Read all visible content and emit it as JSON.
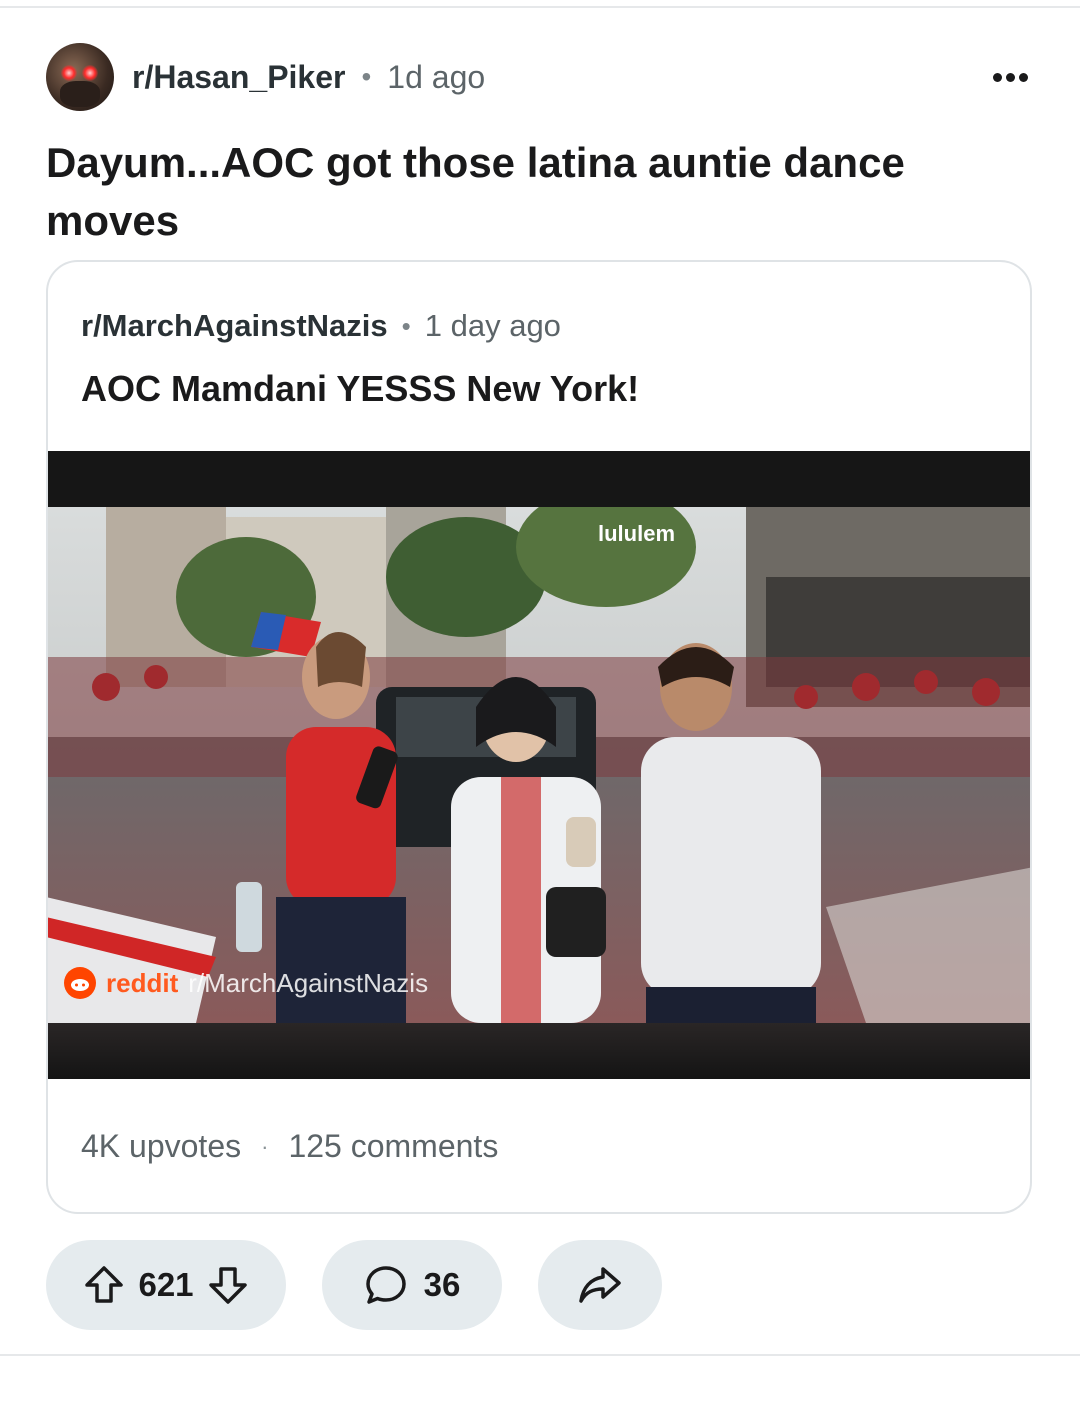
{
  "post": {
    "subreddit": "r/Hasan_Piker",
    "separator": "•",
    "age": "1d ago",
    "title": "Dayum...AOC got those latina auntie dance moves"
  },
  "crosspost": {
    "subreddit": "r/MarchAgainstNazis",
    "separator": "•",
    "age": "1 day ago",
    "title": "AOC Mamdani YESSS New York!",
    "watermark": "reddit",
    "watermark_sub": "r/MarchAgainstNazis",
    "store_sign": "lululem",
    "upvotes": "4K upvotes",
    "stats_separator": "·",
    "comments": "125 comments"
  },
  "actions": {
    "vote_count": "621",
    "comment_count": "36"
  },
  "colors": {
    "pill_bg": "#e5ebee",
    "reddit_orange": "#ff4500"
  },
  "icons": {
    "more": "more-dots-icon",
    "upvote": "upvote-arrow-icon",
    "downvote": "downvote-arrow-icon",
    "comment": "comment-bubble-icon",
    "share": "share-arrow-icon"
  }
}
